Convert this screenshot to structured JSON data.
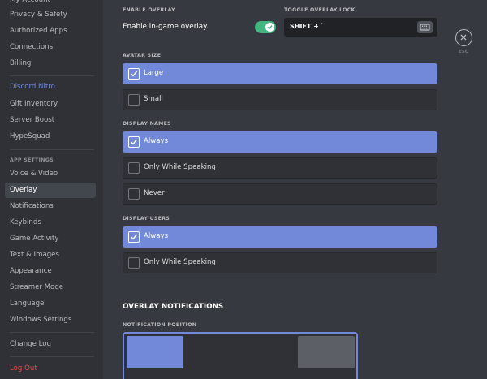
{
  "sidebar": {
    "items_top": [
      {
        "id": "my-account",
        "label": "My Account"
      },
      {
        "id": "privacy-safety",
        "label": "Privacy & Safety"
      },
      {
        "id": "authorized-apps",
        "label": "Authorized Apps"
      },
      {
        "id": "connections",
        "label": "Connections"
      },
      {
        "id": "billing",
        "label": "Billing"
      }
    ],
    "nitro_items": [
      {
        "id": "discord-nitro",
        "label": "Discord Nitro"
      },
      {
        "id": "gift-inventory",
        "label": "Gift Inventory"
      },
      {
        "id": "server-boost",
        "label": "Server Boost"
      },
      {
        "id": "hypesquad",
        "label": "HypeSquad"
      }
    ],
    "app_settings_header": "APP SETTINGS",
    "app_items": [
      {
        "id": "voice-video",
        "label": "Voice & Video"
      },
      {
        "id": "overlay",
        "label": "Overlay"
      },
      {
        "id": "notifications",
        "label": "Notifications"
      },
      {
        "id": "keybinds",
        "label": "Keybinds"
      },
      {
        "id": "game-activity",
        "label": "Game Activity"
      },
      {
        "id": "text-images",
        "label": "Text & Images"
      },
      {
        "id": "appearance",
        "label": "Appearance"
      },
      {
        "id": "streamer-mode",
        "label": "Streamer Mode"
      },
      {
        "id": "language",
        "label": "Language"
      },
      {
        "id": "windows-settings",
        "label": "Windows Settings"
      }
    ],
    "change_log": "Change Log",
    "log_out": "Log Out"
  },
  "overlay": {
    "enable_header": "ENABLE OVERLAY",
    "enable_label": "Enable in-game overlay.",
    "enable_on": true,
    "toggle_lock_header": "TOGGLE OVERLAY LOCK",
    "toggle_lock_value": "SHIFT + `",
    "keyboard_icon": "keyboard-icon",
    "avatar_size_header": "AVATAR SIZE",
    "avatar_options": [
      {
        "label": "Large",
        "selected": true
      },
      {
        "label": "Small",
        "selected": false
      }
    ],
    "display_names_header": "DISPLAY NAMES",
    "display_names_options": [
      {
        "label": "Always",
        "selected": true
      },
      {
        "label": "Only While Speaking",
        "selected": false
      },
      {
        "label": "Never",
        "selected": false
      }
    ],
    "display_users_header": "DISPLAY USERS",
    "display_users_options": [
      {
        "label": "Always",
        "selected": true
      },
      {
        "label": "Only While Speaking",
        "selected": false
      }
    ],
    "notifications_heading": "OVERLAY NOTIFICATIONS",
    "notification_position_header": "NOTIFICATION POSITION"
  },
  "close": {
    "icon": "close-icon",
    "esc_label": "ESC"
  },
  "colors": {
    "accent": "#7289da",
    "toggle_on": "#43b581",
    "danger": "#f04747"
  }
}
